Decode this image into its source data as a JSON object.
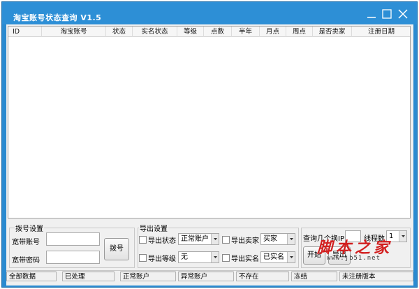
{
  "window": {
    "title": "淘宝账号状态查询 V1.5"
  },
  "list": {
    "columns": [
      "ID",
      "淘宝账号",
      "状态",
      "实名状态",
      "等级",
      "点数",
      "半年",
      "月点",
      "周点",
      "是否卖家",
      "注册日期"
    ]
  },
  "dial_settings": {
    "group_title": "拨号设置",
    "account_label": "宽带账号",
    "account_value": "",
    "password_label": "宽带密码",
    "password_value": "",
    "dial_button": "拨号"
  },
  "export_settings": {
    "group_title": "导出设置",
    "export_status_label": "导出状态",
    "export_status_value": "正常账户",
    "export_seller_label": "导出卖家",
    "export_seller_value": "买家",
    "export_level_label": "导出等级",
    "export_level_value": "无",
    "export_realname_label": "导出实名",
    "export_realname_value": "已实名"
  },
  "query": {
    "switch_label": "查询几个换IP",
    "switch_value": "",
    "threads_label": "线程数",
    "threads_value": "1",
    "start_button": "开始",
    "export_button": "导出"
  },
  "statusbar": {
    "all": "全部数据",
    "processed": "已处理",
    "normal": "正常账户",
    "abnormal": "异常账户",
    "not_exist": "不存在",
    "frozen": "冻结",
    "version": "未注册版本"
  },
  "watermark": {
    "text": "脚本之家",
    "url": "www.jb51.net"
  }
}
